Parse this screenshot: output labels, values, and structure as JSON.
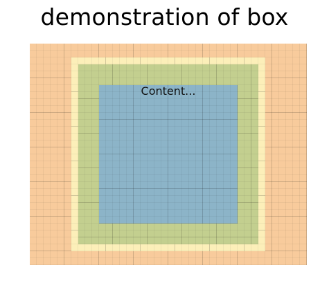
{
  "title": "demonstration of box",
  "content_label": "Content...",
  "colors": {
    "margin": "#f8cb9c",
    "border": "#fcefb9",
    "padding": "#c3cf8f",
    "content": "#8cb4c8"
  }
}
